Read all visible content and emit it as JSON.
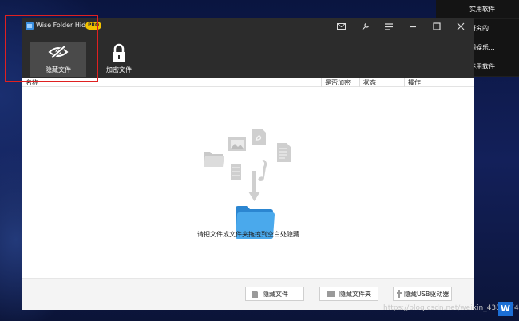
{
  "desktop": {
    "menu_items": [
      "实用软件",
      "研究的...",
      "闷娱乐...",
      "不用软件"
    ],
    "watermark": "https://blog.csdn.net/weixin_4386274",
    "taskbar_icon": "W"
  },
  "window": {
    "title": "Wise Folder Hider",
    "badge": "PRO",
    "titlebar_icons": [
      "mail-icon",
      "settings-wrench-icon",
      "menu-icon",
      "minimize-icon",
      "maximize-icon",
      "close-icon"
    ]
  },
  "toolbar": {
    "hide_file_label": "隐藏文件",
    "encrypt_file_label": "加密文件"
  },
  "columns": {
    "name": "名称",
    "encrypted": "是否加密",
    "status": "状态",
    "action": "操作"
  },
  "empty_state": {
    "text": "请把文件或文件夹拖拽到空白处隐藏"
  },
  "footer": {
    "hide_file_button": "隐藏文件",
    "hide_folder_button": "隐藏文件夹",
    "hide_usb_button": "隐藏USB驱动器"
  },
  "colors": {
    "titlebar": "#2c2c2c",
    "active_tool": "#4a4a4a",
    "badge": "#f3c300",
    "folder_blue": "#3a9be6",
    "highlight_box": "#e02020"
  }
}
